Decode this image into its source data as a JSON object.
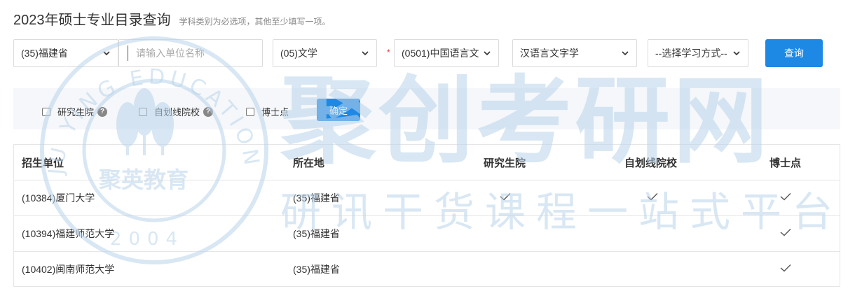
{
  "header": {
    "title": "2023年硕士专业目录查询",
    "hint": "学科类别为必选项，其他至少填写一项。"
  },
  "search": {
    "province": "(35)福建省",
    "unit_placeholder": "请输入单位名称",
    "category": "(05)文学",
    "required_mark": "*",
    "discipline": "(0501)中国语言文",
    "major": "汉语言文字学",
    "study_mode": "--选择学习方式--",
    "query_label": "查询"
  },
  "filters": {
    "grad_school": "研究生院",
    "self_line": "自划线院校",
    "doctoral": "博士点",
    "confirm_label": "确定",
    "help": "?"
  },
  "table": {
    "headers": [
      "招生单位",
      "所在地",
      "研究生院",
      "自划线院校",
      "博士点"
    ],
    "rows": [
      {
        "unit": "(10384)厦门大学",
        "location": "(35)福建省",
        "grad_school": true,
        "self_line": true,
        "doctoral": true
      },
      {
        "unit": "(10394)福建师范大学",
        "location": "(35)福建省",
        "grad_school": false,
        "self_line": false,
        "doctoral": true
      },
      {
        "unit": "(10402)闽南师范大学",
        "location": "(35)福建省",
        "grad_school": false,
        "self_line": false,
        "doctoral": true
      }
    ]
  },
  "watermark": {
    "brand": "聚创考研网",
    "slogan": "研讯干货课程一站式平台",
    "seal_name": "聚英教育",
    "seal_ring": "JU YING EDUCATION",
    "seal_year": "2004"
  },
  "colors": {
    "accent": "#1e88e5",
    "required": "#e4393c",
    "watermark": "#b9d4ea"
  }
}
